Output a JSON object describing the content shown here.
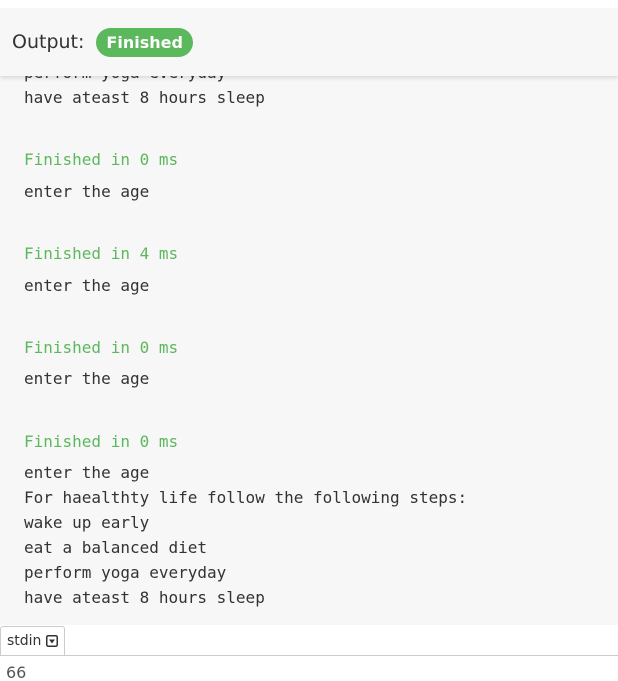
{
  "output": {
    "label": "Output:",
    "status": "Finished",
    "lines": [
      {
        "text": "perform yoga everyday",
        "kind": "stdout"
      },
      {
        "text": "have ateast 8 hours sleep",
        "kind": "stdout"
      },
      {
        "text": "Finished in 0 ms",
        "kind": "finished"
      },
      {
        "text": "enter the age",
        "kind": "stdout"
      },
      {
        "text": "Finished in 4 ms",
        "kind": "finished"
      },
      {
        "text": "enter the age",
        "kind": "stdout"
      },
      {
        "text": "Finished in 0 ms",
        "kind": "finished"
      },
      {
        "text": "enter the age",
        "kind": "stdout"
      },
      {
        "text": "Finished in 0 ms",
        "kind": "finished"
      },
      {
        "text": "enter the age",
        "kind": "stdout"
      },
      {
        "text": "For haealthty life follow the following steps:",
        "kind": "stdout"
      },
      {
        "text": "wake up early",
        "kind": "stdout"
      },
      {
        "text": "eat a balanced diet",
        "kind": "stdout"
      },
      {
        "text": "perform yoga everyday",
        "kind": "stdout"
      },
      {
        "text": "have ateast 8 hours sleep",
        "kind": "stdout"
      }
    ]
  },
  "stdin": {
    "tab_label": "stdin",
    "dropdown_icon": "chevron-down-box-icon",
    "value": "66"
  },
  "colors": {
    "finished_green": "#5cb85c",
    "panel_bg": "#f7f7f7",
    "text": "#333333"
  }
}
